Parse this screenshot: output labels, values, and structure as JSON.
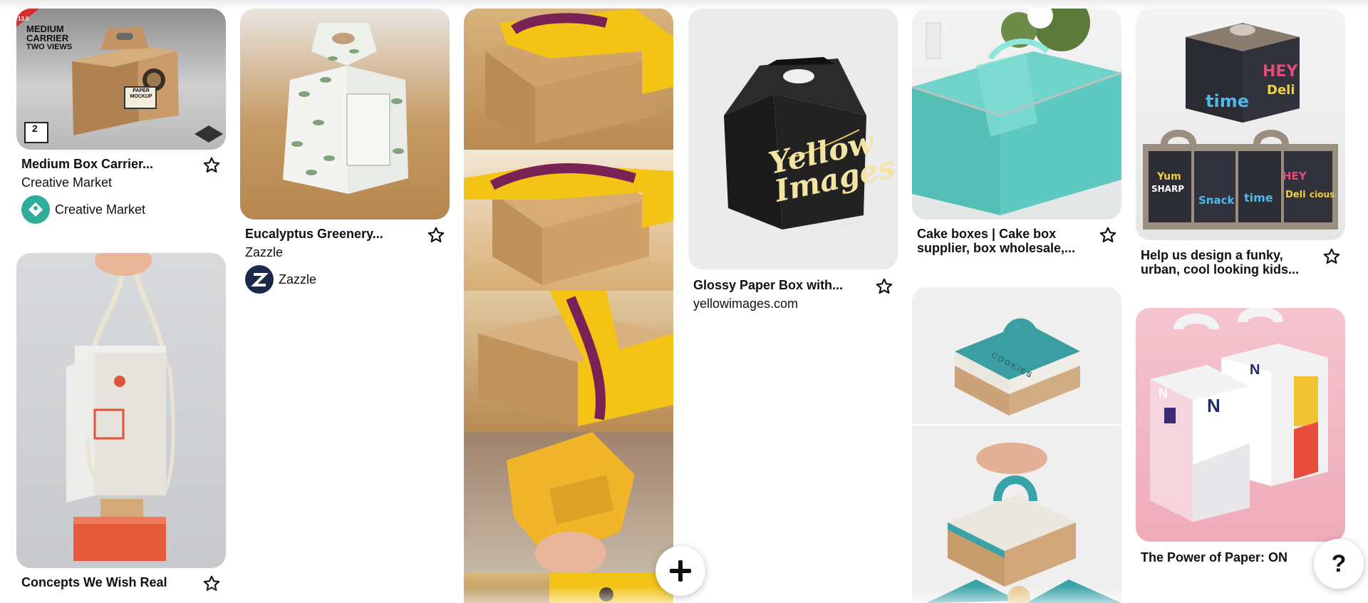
{
  "pins": [
    {
      "id": "p1",
      "title": "Medium Box Carrier...",
      "source": "Creative Market",
      "avatar": {
        "name": "Creative Market",
        "color": "#2eae9a"
      },
      "mockup": {
        "badge": "13.0",
        "line1": "MEDIUM",
        "line2": "CARRIER",
        "line3": "TWO VIEWS",
        "stamp": "PAPER MOCKUP",
        "views": "2"
      }
    },
    {
      "id": "p2",
      "title": "Eucalyptus Greenery...",
      "source": "Zazzle",
      "avatar": {
        "name": "Zazzle",
        "color": "#1b2a4a"
      }
    },
    {
      "id": "p3",
      "title": "Glossy Paper Box with...",
      "source": "yellowimages.com",
      "mockup": {
        "brand_line1": "Yellow",
        "brand_line2": "Images",
        "caption": "BOX MOCKUP"
      }
    },
    {
      "id": "p4",
      "title_line1": "Cake boxes | Cake box",
      "title_line2": "supplier, box wholesale,..."
    },
    {
      "id": "p5",
      "title_line1": "Help us design a funky,",
      "title_line2": "urban, cool looking kids...",
      "mockup": {
        "words": [
          "HEY",
          "Deli",
          "time",
          "Yum",
          "SHARP",
          "Snack",
          "time",
          "HEY",
          "Deli",
          "cious"
        ]
      }
    },
    {
      "id": "p6",
      "title": "Concepts We Wish Real"
    },
    {
      "id": "p7",
      "mockup": {
        "label": "COOKIES"
      }
    },
    {
      "id": "p8",
      "title": "The Power of Paper: ON",
      "mockup": {
        "letter": "N"
      }
    }
  ],
  "controls": {
    "add_label": "+",
    "help_label": "?"
  },
  "icons": {
    "save": "star-outline-icon",
    "add": "plus-icon",
    "help": "question-mark-icon"
  },
  "colors": {
    "yellow_band": "#f3c316",
    "purple_band": "#7a2155",
    "teal_box": "#5ec9c0",
    "teal_trim": "#3aa3a8",
    "pink_bg": "#f2b7c4",
    "kraft": "#c79c6c"
  }
}
